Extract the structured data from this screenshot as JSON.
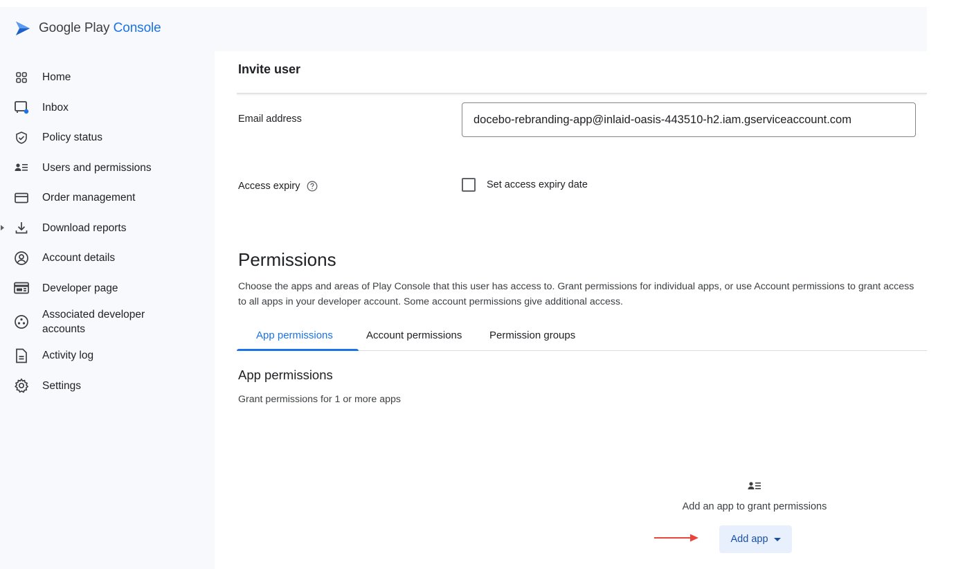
{
  "brand": {
    "name": "Google Play",
    "product": "Console"
  },
  "sidebar": {
    "items": [
      {
        "label": "Home",
        "icon": "home-grid-icon"
      },
      {
        "label": "Inbox",
        "icon": "inbox-icon"
      },
      {
        "label": "Policy status",
        "icon": "shield-check-icon"
      },
      {
        "label": "Users and permissions",
        "icon": "users-permissions-icon"
      },
      {
        "label": "Order management",
        "icon": "credit-card-icon"
      },
      {
        "label": "Download reports",
        "icon": "download-icon",
        "expandable": true
      },
      {
        "label": "Account details",
        "icon": "account-circle-icon"
      },
      {
        "label": "Developer page",
        "icon": "developer-page-icon"
      },
      {
        "label": "Associated developer accounts",
        "icon": "associated-accounts-icon"
      },
      {
        "label": "Activity log",
        "icon": "document-icon"
      },
      {
        "label": "Settings",
        "icon": "gear-icon"
      }
    ]
  },
  "main": {
    "invite_title": "Invite user",
    "email": {
      "label": "Email address",
      "value": "docebo-rebranding-app@inlaid-oasis-443510-h2.iam.gserviceaccount.com"
    },
    "access_expiry": {
      "label": "Access expiry",
      "help_icon": "help-circle-icon",
      "checkbox_label": "Set access expiry date",
      "checked": false
    },
    "permissions": {
      "title": "Permissions",
      "description": "Choose the apps and areas of Play Console that this user has access to. Grant permissions for individual apps, or use Account permissions to grant access to all apps in your developer account. Some account permissions give additional access.",
      "tabs": [
        {
          "label": "App permissions",
          "active": true
        },
        {
          "label": "Account permissions",
          "active": false
        },
        {
          "label": "Permission groups",
          "active": false
        }
      ],
      "section_title": "App permissions",
      "section_subtitle": "Grant permissions for 1 or more apps",
      "empty_state": {
        "icon": "users-permissions-icon",
        "text": "Add an app to grant permissions",
        "button_label": "Add app"
      }
    }
  },
  "colors": {
    "accent": "#1a73e8",
    "sidebar_bg": "#f8f9fc",
    "button_bg": "#e8f0fe",
    "button_text": "#174ea6",
    "annotation_arrow": "#e8453c"
  }
}
